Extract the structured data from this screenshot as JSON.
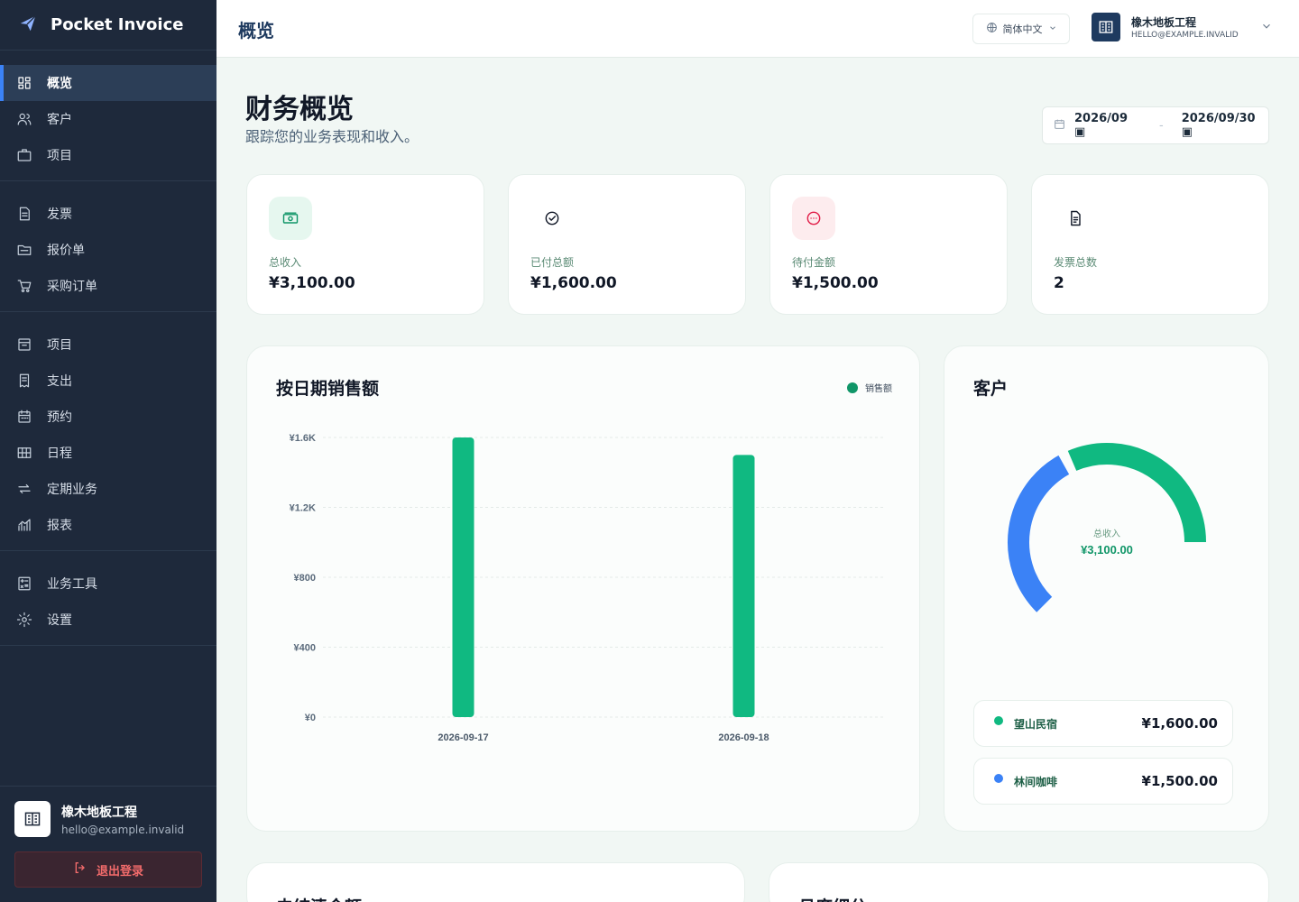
{
  "app": {
    "name": "Pocket Invoice"
  },
  "sidebar": {
    "groups": [
      [
        {
          "label": "概览",
          "icon": "dashboard-icon",
          "active": true
        },
        {
          "label": "客户",
          "icon": "users-icon"
        },
        {
          "label": "项目",
          "icon": "briefcase-icon"
        }
      ],
      [
        {
          "label": "发票",
          "icon": "document-icon"
        },
        {
          "label": "报价单",
          "icon": "folder-icon"
        },
        {
          "label": "采购订单",
          "icon": "cart-icon"
        }
      ],
      [
        {
          "label": "项目",
          "icon": "archive-icon"
        },
        {
          "label": "支出",
          "icon": "receipt-icon"
        },
        {
          "label": "预约",
          "icon": "calendar-icon"
        },
        {
          "label": "日程",
          "icon": "table-icon"
        },
        {
          "label": "定期业务",
          "icon": "repeat-icon"
        },
        {
          "label": "报表",
          "icon": "chart-icon"
        }
      ],
      [
        {
          "label": "业务工具",
          "icon": "calculator-icon"
        },
        {
          "label": "设置",
          "icon": "gear-icon"
        }
      ]
    ],
    "account": {
      "name": "橡木地板工程",
      "email": "hello@example.invalid"
    },
    "logout_label": "退出登录"
  },
  "header": {
    "title": "概览",
    "language": "简体中文",
    "org_name": "橡木地板工程",
    "org_email": "HELLO@EXAMPLE.INVALID"
  },
  "main": {
    "title": "财务概览",
    "subtitle": "跟踪您的业务表现和收入。",
    "date_from": "2026/09",
    "date_to": "2026/09/30",
    "date_sep": "-",
    "stats": [
      {
        "label": "总收入",
        "value": "¥3,100.00",
        "icon": "cash-icon",
        "bg": "#e6f7ef",
        "color": "#109668"
      },
      {
        "label": "已付总额",
        "value": "¥1,600.00",
        "icon": "check-circle-icon",
        "bg": "#ffffff",
        "color": "#111827"
      },
      {
        "label": "待付金额",
        "value": "¥1,500.00",
        "icon": "pending-icon",
        "bg": "#fdecee",
        "color": "#e11d48"
      },
      {
        "label": "发票总数",
        "value": "2",
        "icon": "invoice-icon",
        "bg": "#ffffff",
        "color": "#111827"
      }
    ],
    "sales_panel": {
      "title": "按日期销售额",
      "legend": "销售额"
    },
    "customers_panel": {
      "title": "客户",
      "center_label": "总收入",
      "center_value": "¥3,100.00",
      "rows": [
        {
          "name": "望山民宿",
          "amount": "¥1,600.00",
          "color": "#10b981"
        },
        {
          "name": "林间咖啡",
          "amount": "¥1,500.00",
          "color": "#3b82f6"
        }
      ]
    },
    "bottom_titles": [
      "未结清金额",
      "月度细分"
    ]
  },
  "chart_data": [
    {
      "type": "bar",
      "title": "按日期销售额",
      "categories": [
        "2026-09-17",
        "2026-09-18"
      ],
      "series": [
        {
          "name": "销售额",
          "values": [
            1600,
            1500
          ]
        }
      ],
      "ylim": [
        0,
        1600
      ],
      "yticks": [
        "¥0",
        "¥400",
        "¥800",
        "¥1.2K",
        "¥1.6K"
      ],
      "grid": true,
      "legend": "top-right",
      "color": "#10b981"
    },
    {
      "type": "pie",
      "title": "客户",
      "categories": [
        "望山民宿",
        "林间咖啡"
      ],
      "values": [
        1600,
        1500
      ],
      "colors": [
        "#10b981",
        "#3b82f6"
      ]
    }
  ]
}
